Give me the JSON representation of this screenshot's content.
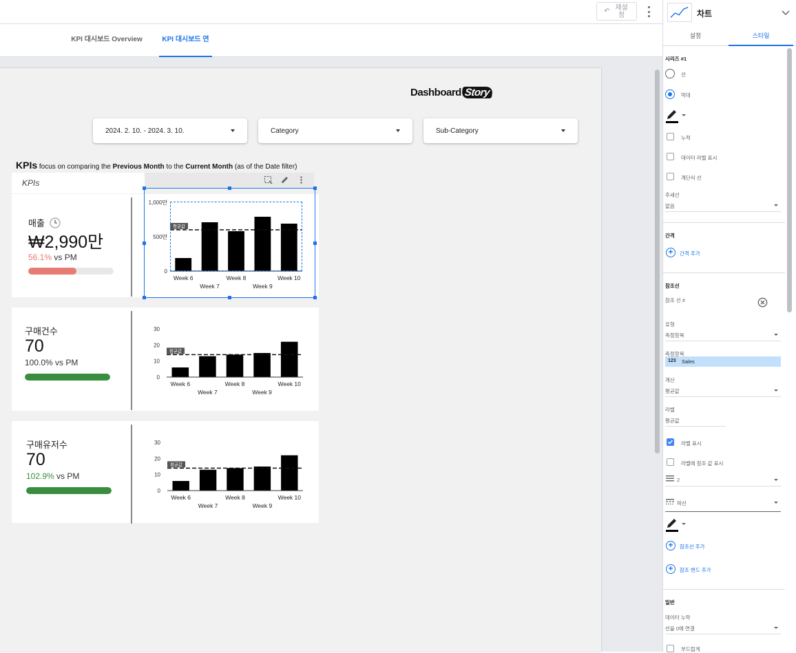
{
  "toolbar": {
    "reset_label": "재설정"
  },
  "tabs": [
    {
      "label": "KPI 대시보드 Overview",
      "active": false
    },
    {
      "label": "KPI 대시보드 연습",
      "active": true
    }
  ],
  "logo": {
    "text": "Dashboard",
    "text2": "Story"
  },
  "filters": {
    "date": "2024. 2. 10. - 2024. 3. 10.",
    "category": "Category",
    "subcategory": "Sub-Category"
  },
  "heading": {
    "kpis": "KPIs",
    "part1": " focus on comparing the ",
    "previous": "Previous Month",
    "part2": " to the ",
    "current": "Current Month",
    "part3": " (as of the Date filter)"
  },
  "kpis_tab": "KPIs",
  "cards": [
    {
      "label": "매출",
      "value": "₩2,990만",
      "change_pct": "56.1%",
      "change_suffix": " vs PM",
      "progress": 0.561,
      "color": "#e67c73"
    },
    {
      "label": "구매건수",
      "value": "70",
      "change_pct": "100.0%",
      "change_suffix": " vs PM",
      "progress": 1.0,
      "color": "#388e3c"
    },
    {
      "label": "구매유저수",
      "value": "70",
      "change_pct": "102.9%",
      "change_suffix": " vs PM",
      "progress": 1.0,
      "color": "#388e3c"
    }
  ],
  "chart_data": [
    {
      "type": "bar",
      "categories": [
        "Week 6",
        "Week 7",
        "Week 8",
        "Week 9",
        "Week 10"
      ],
      "values": [
        190,
        710,
        580,
        790,
        690
      ],
      "ylim": [
        0,
        1000
      ],
      "yticks": [
        "0",
        "500만",
        "1,000만"
      ],
      "reference_line": {
        "value": 600,
        "label": "평균값"
      }
    },
    {
      "type": "bar",
      "categories": [
        "Week 6",
        "Week 7",
        "Week 8",
        "Week 9",
        "Week 10"
      ],
      "values": [
        6,
        13,
        14,
        15,
        22
      ],
      "ylim": [
        0,
        30
      ],
      "yticks": [
        "0",
        "10",
        "20",
        "30"
      ],
      "reference_line": {
        "value": 14,
        "label": "평균값"
      }
    },
    {
      "type": "bar",
      "categories": [
        "Week 6",
        "Week 7",
        "Week 8",
        "Week 9",
        "Week 10"
      ],
      "values": [
        6,
        13,
        14,
        15,
        22
      ],
      "ylim": [
        0,
        30
      ],
      "yticks": [
        "0",
        "10",
        "20",
        "30"
      ],
      "reference_line": {
        "value": 14,
        "label": "평균값"
      }
    }
  ],
  "sidebar": {
    "title": "차트",
    "tabs": [
      "설정",
      "스타일"
    ],
    "series_label": "시리즈 #1",
    "radio_line": "선",
    "radio_bar": "막대",
    "cumulative": "누적",
    "show_data_labels": "데이터 라벨 표시",
    "step_line": "계단식 선",
    "trendline_label": "추세선",
    "trendline_value": "없음",
    "interval_head": "간격",
    "add_interval": "간격 추가",
    "refline_head": "참조선",
    "refline_item": "참조 선 #",
    "type_label": "유형",
    "type_value": "측정항목",
    "metric_label": "측정항목",
    "metric_chip_icon": "123",
    "metric_chip": "Sales",
    "calc_label": "계산",
    "calc_value": "평균값",
    "label_label": "라벨",
    "label_value": "평균값",
    "show_label": "라벨 표시",
    "show_ref_in_label": "라벨에 참조 값 표시",
    "weight_value": "2",
    "dash_value": "파선",
    "add_refline": "참조선 추가",
    "add_refband": "참조 밴드 추가",
    "general_head": "일반",
    "missing_label": "데이터 누락",
    "missing_value": "선을 0에 연결",
    "smooth": "부드럽게"
  }
}
